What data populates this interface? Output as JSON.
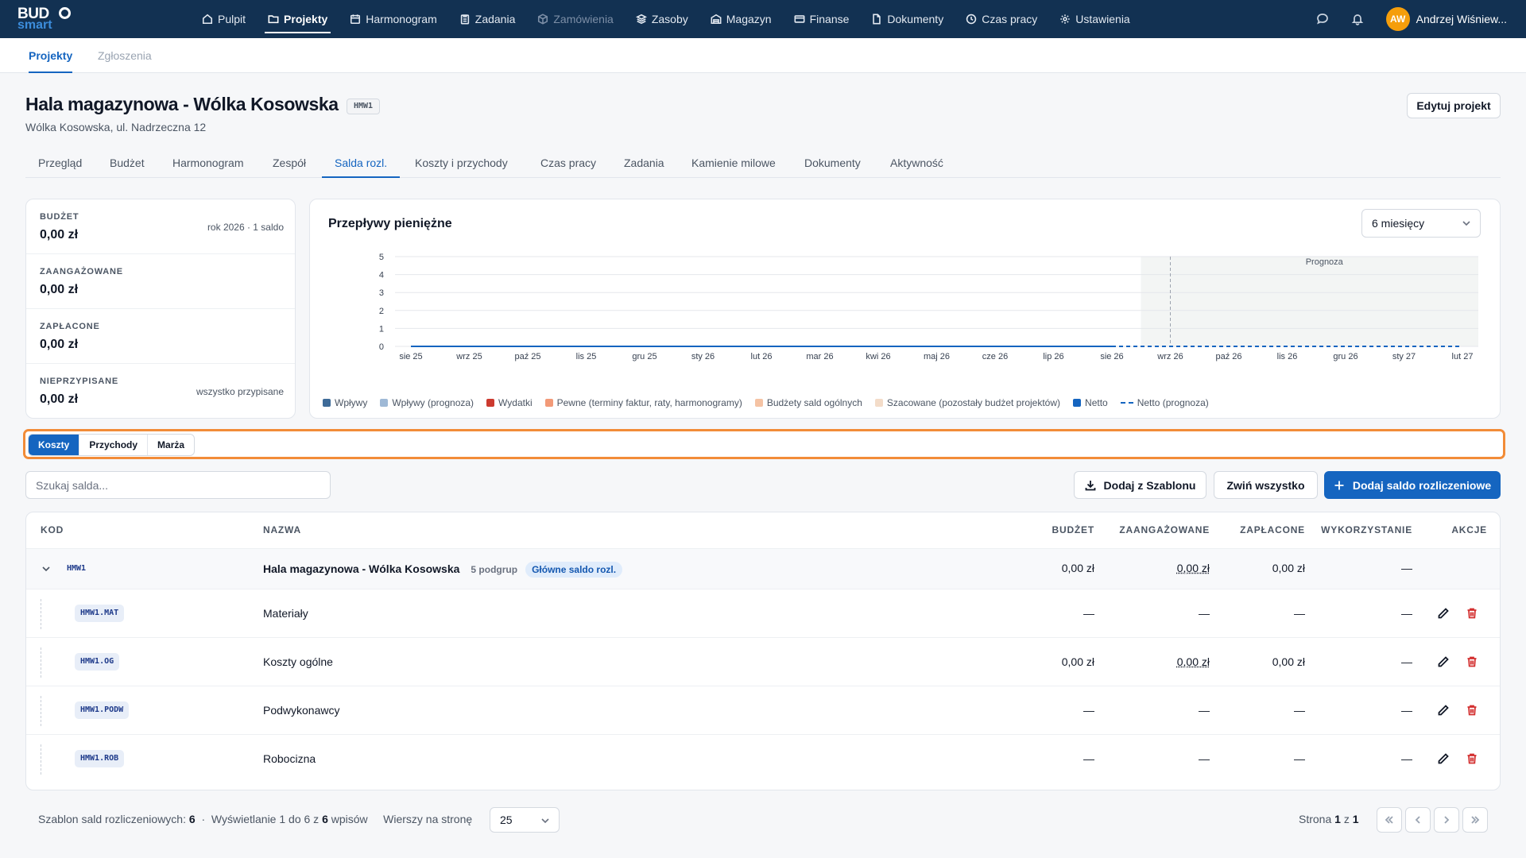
{
  "app": {
    "logo_top": "BUD",
    "logo_bottom": "smart"
  },
  "nav": [
    {
      "label": "Pulpit",
      "icon": "home-icon",
      "state": ""
    },
    {
      "label": "Projekty",
      "icon": "folder-icon",
      "state": "active"
    },
    {
      "label": "Harmonogram",
      "icon": "calendar-icon",
      "state": ""
    },
    {
      "label": "Zadania",
      "icon": "clipboard-icon",
      "state": ""
    },
    {
      "label": "Zamówienia",
      "icon": "package-icon",
      "state": "disabled"
    },
    {
      "label": "Zasoby",
      "icon": "layers-icon",
      "state": ""
    },
    {
      "label": "Magazyn",
      "icon": "warehouse-icon",
      "state": ""
    },
    {
      "label": "Finanse",
      "icon": "credit-card-icon",
      "state": ""
    },
    {
      "label": "Dokumenty",
      "icon": "document-icon",
      "state": ""
    },
    {
      "label": "Czas pracy",
      "icon": "clock-icon",
      "state": ""
    },
    {
      "label": "Ustawienia",
      "icon": "gear-icon",
      "state": ""
    }
  ],
  "user": {
    "initials": "AW",
    "name": "Andrzej Wiśniew..."
  },
  "subnav": {
    "tabs": [
      "Projekty",
      "Zgłoszenia"
    ]
  },
  "project": {
    "title": "Hala magazynowa - Wólka Kosowska",
    "code": "HMW1",
    "address": "Wólka Kosowska, ul. Nadrzeczna 12",
    "edit_label": "Edytuj projekt"
  },
  "project_tabs": [
    "Przegląd",
    "Budżet",
    "Harmonogram",
    "Zespół",
    "Salda rozl.",
    "Koszty i przychody",
    "Czas pracy",
    "Zadania",
    "Kamienie milowe",
    "Dokumenty",
    "Aktywność"
  ],
  "summary": [
    {
      "label": "BUDŻET",
      "value": "0,00 zł",
      "note": "rok 2026 · 1 saldo"
    },
    {
      "label": "ZAANGAŻOWANE",
      "value": "0,00 zł",
      "note": ""
    },
    {
      "label": "ZAPŁACONE",
      "value": "0,00 zł",
      "note": ""
    },
    {
      "label": "NIEPRZYPISANE",
      "value": "0,00 zł",
      "note": "wszystko przypisane"
    }
  ],
  "chart_data": {
    "type": "line",
    "title": "Przepływy pieniężne",
    "period_select": "6 miesięcy",
    "x": [
      "sie 25",
      "wrz 25",
      "paź 25",
      "lis 25",
      "gru 25",
      "sty 26",
      "lut 26",
      "mar 26",
      "kwi 26",
      "maj 26",
      "cze 26",
      "lip 26",
      "sie 26",
      "wrz 26",
      "paź 26",
      "lis 26",
      "gru 26",
      "sty 27",
      "lut 27"
    ],
    "y_ticks": [
      0,
      1,
      2,
      3,
      4,
      5
    ],
    "ylim": [
      0,
      5
    ],
    "forecast_label": "Prognoza",
    "forecast_from": "wrz 26",
    "series": [
      {
        "name": "Netto",
        "values": [
          0,
          0,
          0,
          0,
          0,
          0,
          0,
          0,
          0,
          0,
          0,
          0,
          0
        ]
      },
      {
        "name": "Netto (prognoza)",
        "values": [
          0,
          0,
          0,
          0,
          0,
          0,
          0
        ]
      }
    ],
    "legend": [
      {
        "name": "Wpływy",
        "color": "#3e6b98",
        "style": "box"
      },
      {
        "name": "Wpływy (prognoza)",
        "color": "#9fb9d6",
        "style": "box"
      },
      {
        "name": "Wydatki",
        "color": "#cc3a2f",
        "style": "box"
      },
      {
        "name": "Pewne (terminy faktur, raty, harmonogramy)",
        "color": "#f29a78",
        "style": "box"
      },
      {
        "name": "Budżety sald ogólnych",
        "color": "#f5c3a4",
        "style": "box"
      },
      {
        "name": "Szacowane (pozostały budżet projektów)",
        "color": "#f3dcc9",
        "style": "box"
      },
      {
        "name": "Netto",
        "color": "#1565c0",
        "style": "box"
      },
      {
        "name": "Netto (prognoza)",
        "color": "#1565c0",
        "style": "dash"
      }
    ],
    "grid": true,
    "legend_position": "bottom"
  },
  "toggle": [
    "Koszty",
    "Przychody",
    "Marża"
  ],
  "search": {
    "placeholder": "Szukaj salda..."
  },
  "actions": {
    "template": "Dodaj z Szablonu",
    "collapse": "Zwiń wszystko",
    "add": "Dodaj saldo rozliczeniowe"
  },
  "table": {
    "headers": [
      "KOD",
      "NAZWA",
      "BUDŻET",
      "ZAANGAŻOWANE",
      "ZAPŁACONE",
      "WYKORZYSTANIE",
      "AKCJE"
    ],
    "parent": {
      "code": "HMW1",
      "name": "Hala magazynowa - Wólka Kosowska",
      "sub": "5 podgrup",
      "badge": "Główne saldo rozl.",
      "budget": "0,00 zł",
      "committed": "0,00 zł",
      "paid": "0,00 zł",
      "usage": "—"
    },
    "rows": [
      {
        "code": "HMW1.MAT",
        "name": "Materiały",
        "budget": "—",
        "committed": "—",
        "paid": "—",
        "usage": "—"
      },
      {
        "code": "HMW1.OG",
        "name": "Koszty ogólne",
        "budget": "0,00 zł",
        "committed": "0,00 zł",
        "paid": "0,00 zł",
        "usage": "—"
      },
      {
        "code": "HMW1.PODW",
        "name": "Podwykonawcy",
        "budget": "—",
        "committed": "—",
        "paid": "—",
        "usage": "—"
      },
      {
        "code": "HMW1.ROB",
        "name": "Robocizna",
        "budget": "—",
        "committed": "—",
        "paid": "—",
        "usage": "—"
      }
    ]
  },
  "footer": {
    "template_label": "Szablon sald rozliczeniowych:",
    "template_count": "6",
    "sep": "·",
    "showing_prefix": "Wyświetlanie 1 do 6 z",
    "showing_total": "6",
    "showing_suffix": "wpisów",
    "rows_label": "Wierszy na stronę",
    "rows_value": "25",
    "page_prefix": "Strona",
    "page_current": "1",
    "page_of": "z",
    "page_total": "1"
  }
}
